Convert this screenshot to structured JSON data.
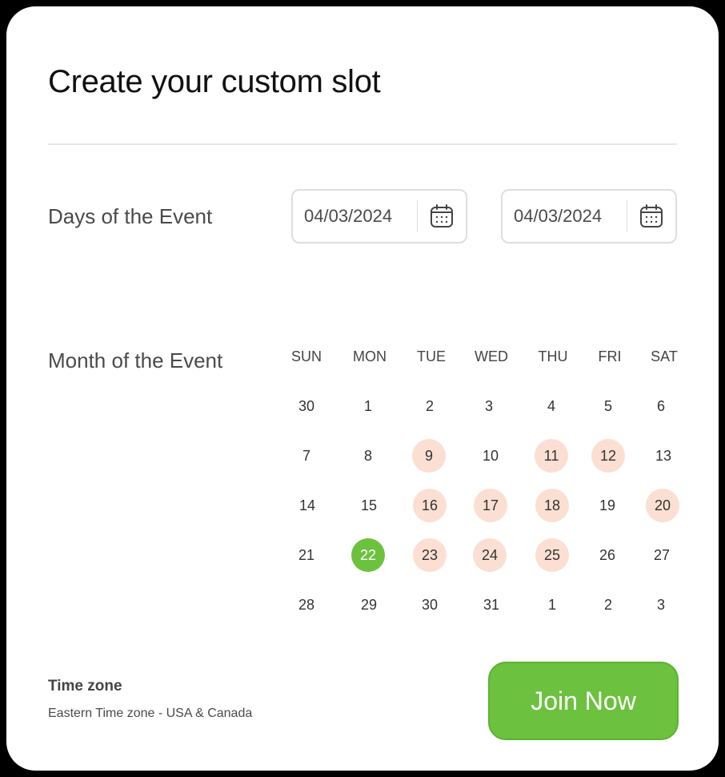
{
  "title": "Create your custom slot",
  "days_section": {
    "label": "Days of the Event",
    "start_date": "04/03/2024",
    "end_date": "04/03/2024"
  },
  "month_section": {
    "label": "Month of the Event",
    "weekdays": [
      "SUN",
      "MON",
      "TUE",
      "WED",
      "THU",
      "FRI",
      "SAT"
    ],
    "weeks": [
      [
        "30",
        "1",
        "2",
        "3",
        "4",
        "5",
        "6"
      ],
      [
        "7",
        "8",
        "9",
        "10",
        "11",
        "12",
        "13"
      ],
      [
        "14",
        "15",
        "16",
        "17",
        "18",
        "19",
        "20"
      ],
      [
        "21",
        "22",
        "23",
        "24",
        "25",
        "26",
        "27"
      ],
      [
        "28",
        "29",
        "30",
        "31",
        "1",
        "2",
        "3"
      ]
    ],
    "highlighted_days": [
      "9",
      "11",
      "12",
      "16",
      "17",
      "18",
      "20",
      "23",
      "24",
      "25"
    ],
    "selected_day": "22"
  },
  "timezone": {
    "label": "Time zone",
    "value": "Eastern Time zone - USA & Canada"
  },
  "join_button": {
    "label": "Join Now"
  },
  "colors": {
    "accent": "#6cc13f",
    "highlight": "#fbdfd2",
    "frame": "#000000"
  },
  "icons": {
    "date_picker": "calendar-icon"
  }
}
